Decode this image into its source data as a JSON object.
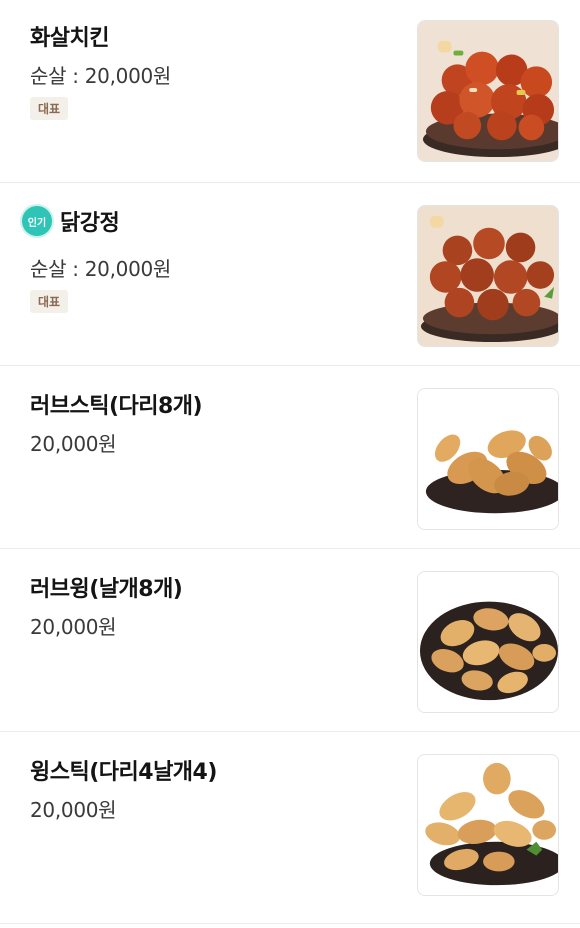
{
  "menu": {
    "items": [
      {
        "name": "화살치킨",
        "price": "순살 : 20,000원",
        "badge": "대표",
        "image_icon": "spicy-boneless-chicken-image"
      },
      {
        "name": "닭강정",
        "popular_label": "인기",
        "price": "순살 : 20,000원",
        "badge": "대표",
        "image_icon": "sweet-chicken-bites-image"
      },
      {
        "name": "러브스틱(다리8개)",
        "price": "20,000원",
        "image_icon": "fried-drumsticks-image"
      },
      {
        "name": "러브윙(날개8개)",
        "price": "20,000원",
        "image_icon": "fried-wings-image"
      },
      {
        "name": "윙스틱(다리4날개4)",
        "price": "20,000원",
        "image_icon": "fried-wings-drumsticks-image"
      }
    ]
  },
  "colors": {
    "popular_badge": "#2ec4b6",
    "rep_badge_bg": "#f3efe9",
    "rep_badge_text": "#8a6a52"
  }
}
